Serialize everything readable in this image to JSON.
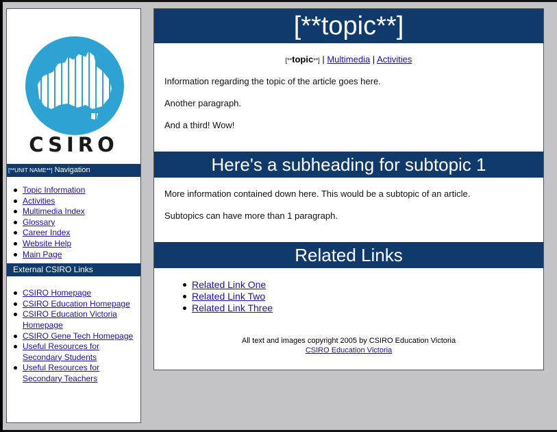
{
  "colors": {
    "accent": "#0f3a6b",
    "link": "#1c0fa8",
    "background": "#c4c3c8",
    "logo_circle": "#2ea3d3"
  },
  "logo": {
    "text": "CSIRO"
  },
  "sidebar": {
    "nav_header_unit": "[**UNIT NAME**]",
    "nav_header_label": "Navigation",
    "nav_items": [
      "Topic Information",
      "Activities",
      "Multimedia Index",
      "Glossary",
      "Career Index",
      "Website Help",
      "Main Page"
    ],
    "external_header": "External CSIRO Links",
    "external_items": [
      "CSIRO Homepage",
      "CSIRO Education Homepage",
      "CSIRO Education Victoria Homepage",
      "CSIRO Gene Tech Homepage",
      "Useful Resources for Secondary Students",
      "Useful Resources for Secondary Teachers"
    ]
  },
  "main": {
    "title": "[**topic**]",
    "breadcrumb": {
      "prefix": "[**",
      "current": "topic",
      "suffix": "**]",
      "sep": " | ",
      "links": [
        "Multimedia",
        "Activities"
      ]
    },
    "paragraphs": [
      "Information regarding the topic of the article goes here.",
      "Another paragraph.",
      "And a third! Wow!"
    ],
    "subheading": "Here's a subheading for subtopic 1",
    "sub_paragraphs": [
      "More information contained down here. This would be a subtopic of an article.",
      "Subtopics can have more than 1 paragraph."
    ],
    "related_heading": "Related Links",
    "related_links": [
      "Related Link One",
      "Related Link Two",
      "Related Link Three"
    ],
    "footer_text": "All text and images copyright 2005 by CSIRO Education Victoria",
    "footer_link": "CSIRO Education Victoria"
  }
}
